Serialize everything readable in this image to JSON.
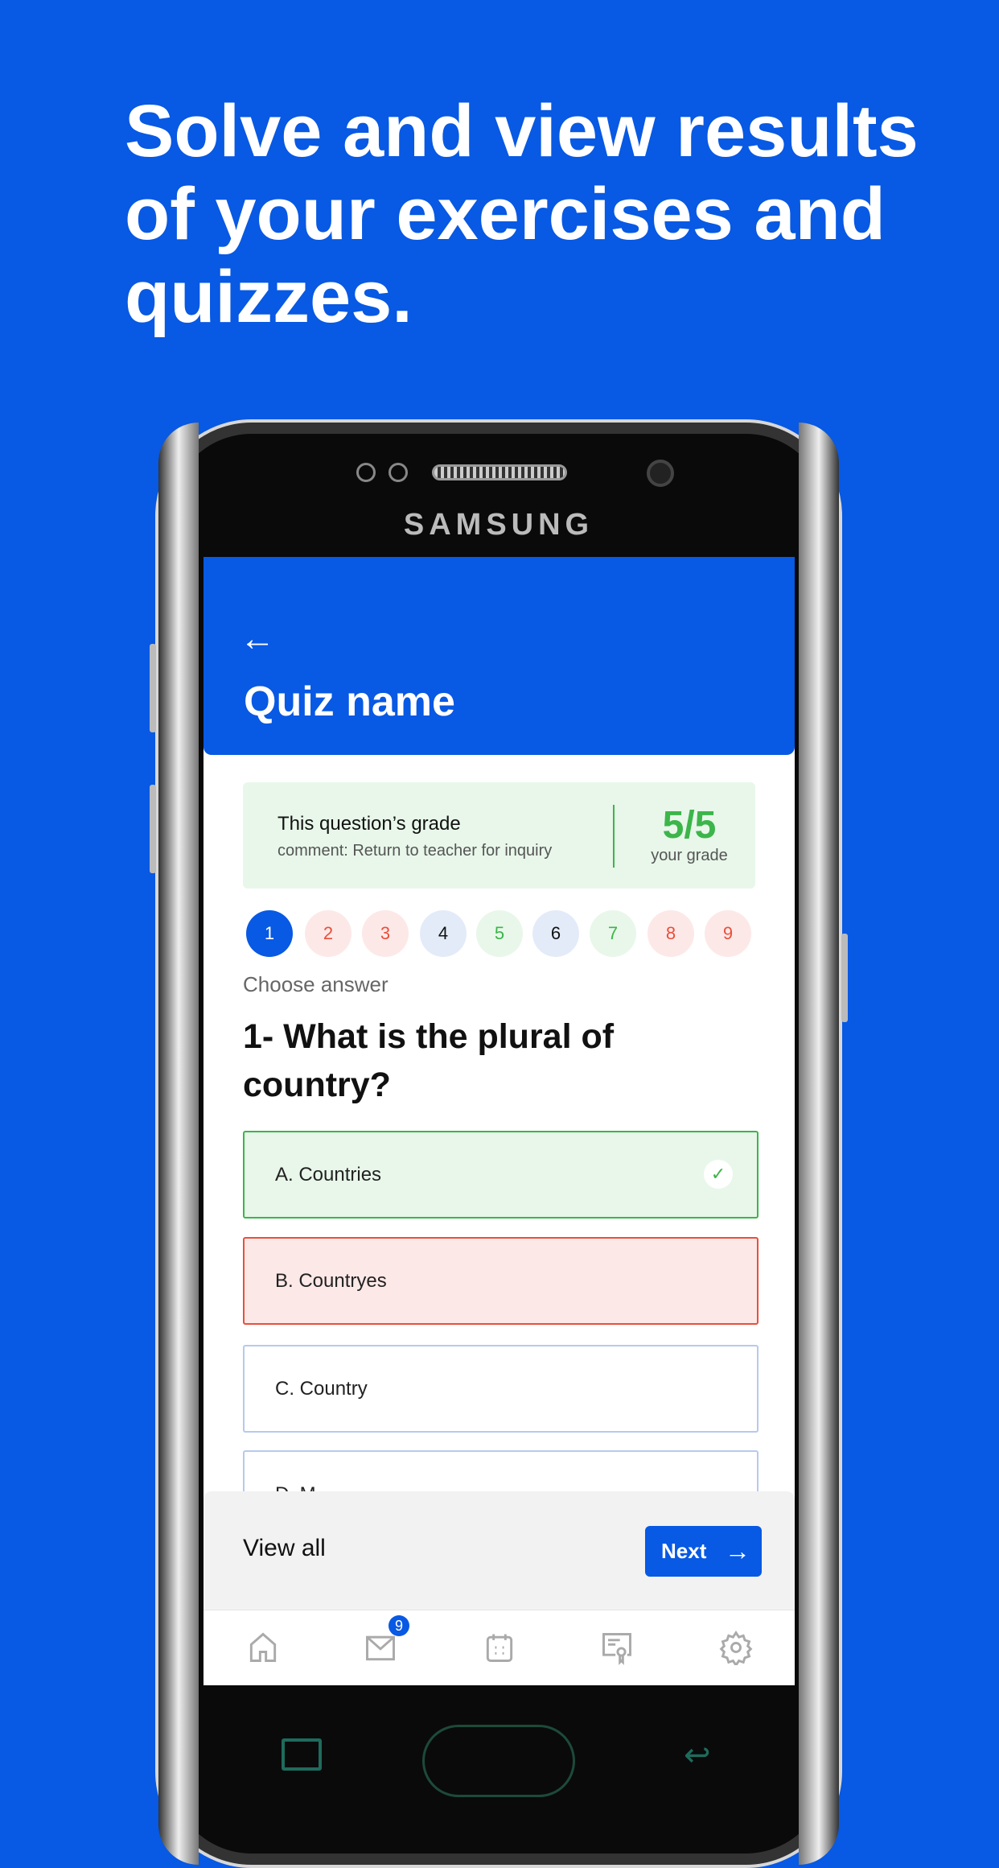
{
  "headline": "Solve and view results of your exercises and quizzes.",
  "device_brand": "SAMSUNG",
  "header": {
    "title": "Quiz name",
    "back_icon": "arrow-left-icon"
  },
  "grade": {
    "title": "This question’s grade",
    "comment": "comment: Return to teacher for inquiry",
    "score": "5/5",
    "score_label": "your grade"
  },
  "questions": [
    {
      "n": "1",
      "state": "current"
    },
    {
      "n": "2",
      "state": "wrong"
    },
    {
      "n": "3",
      "state": "wrong"
    },
    {
      "n": "4",
      "state": "unanswered"
    },
    {
      "n": "5",
      "state": "correct"
    },
    {
      "n": "6",
      "state": "unanswered"
    },
    {
      "n": "7",
      "state": "correct"
    },
    {
      "n": "8",
      "state": "wrong"
    },
    {
      "n": "9",
      "state": "wrong"
    }
  ],
  "instruction": "Choose  answer",
  "question": "1- What is the plural of country?",
  "options": [
    {
      "label": "A. Countries",
      "state": "correct"
    },
    {
      "label": "B. Countryes",
      "state": "wrong"
    },
    {
      "label": "C. Country",
      "state": "neutral"
    },
    {
      "label": "D. M...",
      "state": "neutral"
    }
  ],
  "footer": {
    "view_all": "View all",
    "next": "Next"
  },
  "nav": [
    {
      "icon": "home-icon"
    },
    {
      "icon": "mail-icon",
      "badge": "9"
    },
    {
      "icon": "calendar-icon"
    },
    {
      "icon": "certificate-icon"
    },
    {
      "icon": "gear-icon"
    }
  ],
  "colors": {
    "brand": "#0859e3",
    "correct": "#3cb54a",
    "wrong": "#e8503a"
  }
}
